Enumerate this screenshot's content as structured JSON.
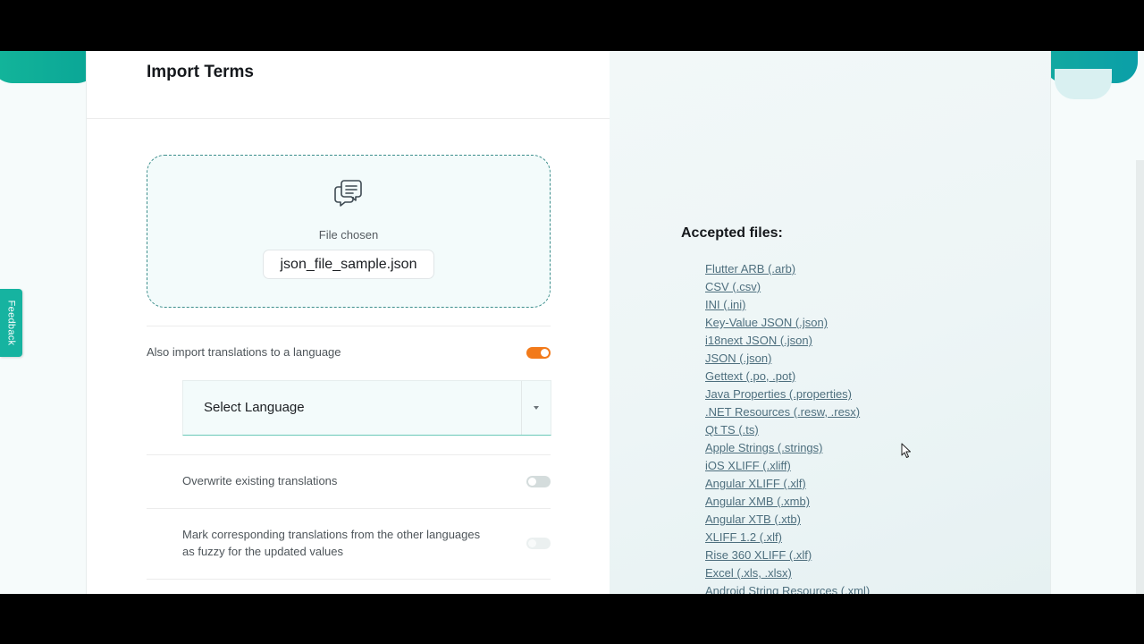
{
  "panel": {
    "title": "Import Terms"
  },
  "dropzone": {
    "icon": "file-chat-icon",
    "label": "File chosen",
    "file_name": "json_file_sample.json"
  },
  "options": {
    "import_translations": {
      "label": "Also import translations to a language",
      "enabled": true
    },
    "language_select": {
      "placeholder": "Select Language"
    },
    "overwrite": {
      "label": "Overwrite existing translations",
      "enabled": false
    },
    "mark_fuzzy": {
      "label_line1": "Mark corresponding translations from the other languages",
      "label_line2": "as fuzzy for the updated values",
      "enabled": false
    }
  },
  "accepted": {
    "title": "Accepted files:",
    "formats": [
      "Flutter ARB (.arb)",
      "CSV (.csv)",
      "INI (.ini)",
      "Key-Value JSON (.json)",
      "i18next JSON (.json)",
      "JSON (.json)",
      "Gettext (.po, .pot)",
      "Java Properties (.properties)",
      ".NET Resources (.resw, .resx)",
      "Qt TS (.ts)",
      "Apple Strings (.strings)",
      "iOS XLIFF (.xliff)",
      "Angular XLIFF (.xlf)",
      "Angular XMB (.xmb)",
      "Angular XTB (.xtb)",
      "XLIFF 1.2 (.xlf)",
      "Rise 360 XLIFF (.xlf)",
      "Excel (.xls, .xlsx)",
      "Android String Resources (.xml)"
    ]
  },
  "feedback": {
    "label": "Feedback"
  },
  "colors": {
    "accent_teal": "#13b59a",
    "toggle_on": "#f27a1a",
    "link": "#4e6f7e"
  }
}
